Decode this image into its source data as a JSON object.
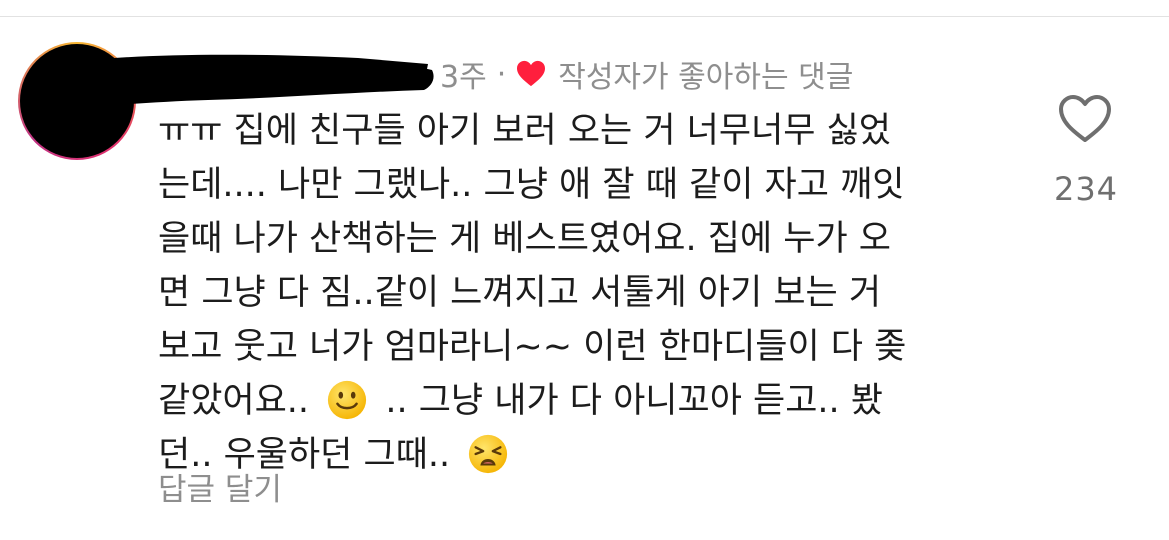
{
  "comment": {
    "time_ago": "3주",
    "separator": "·",
    "author_liked_label": "작성자가 좋아하는 댓글",
    "body_lines": [
      "ㅠㅠ 집에 친구들 아기 보러 오는 거 너무너무 싫었",
      "는데.... 나만 그랬나.. 그냥 애 잘 때 같이 자고 깨잇",
      "을때 나가 산책하는 게 베스트였어요. 집에 누가 오",
      "면 그냥 다 짐..같이 느껴지고 서툴게 아기 보는 거",
      "보고 웃고 너가 엄마라니~~ 이런 한마디들이 다 좆"
    ],
    "line6_before_emoji": "같았어요..",
    "line6_after_emoji": ".. 그냥 내가 다 아니꼬아 듣고.. 봤",
    "line7": "던.. 우울하던 그때..",
    "emoji_1": "slightly-smiling-face",
    "emoji_2": "weary-face",
    "reply_label": "답글 달기"
  },
  "like": {
    "count": "234",
    "icon": "heart-outline-icon"
  },
  "colors": {
    "text": "#1c1c1c",
    "muted": "#8e8e8e",
    "heart_red": "#ff1f3d",
    "count": "#6f6f6f"
  }
}
